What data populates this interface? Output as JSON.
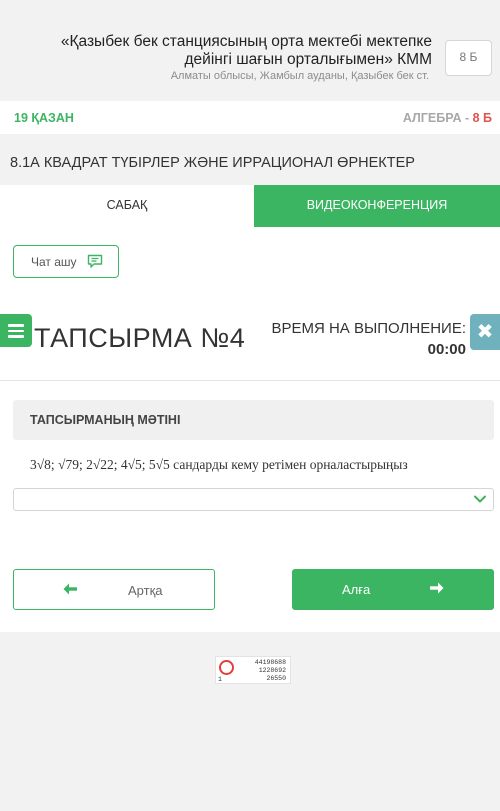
{
  "header": {
    "school_name": "«Қазыбек бек станциясының орта мектебі мектепке дейінгі шағын орталығымен» КММ",
    "address": "Алматы облысы, Жамбыл ауданы, Қазыбек бек ст.",
    "class": "8 Б"
  },
  "lesson": {
    "date": "19 ҚАЗАН",
    "subject": "АЛГЕБРА",
    "subject_sep": " - ",
    "grade": "8 Б",
    "topic": "8.1А КВАДРАТ ТҮБІРЛЕР ЖӘНЕ ИРРАЦИОНАЛ ӨРНЕКТЕР"
  },
  "tabs": {
    "lesson": "САБАҚ",
    "video": "ВИДЕОКОНФЕРЕНЦИЯ"
  },
  "chat": {
    "label": "Чат ашу",
    "icon": "chat-bubble-icon"
  },
  "task": {
    "title": "ТАПСЫРМА №4",
    "time_label": "ВРЕМЯ НА ВЫПОЛНЕНИЕ:",
    "time_value": "00:00",
    "text_header": "ТАПСЫРМАНЫҢ МӘТІНІ",
    "question": "3√8; √79; 2√22; 4√5; 5√5 сандарды кему ретімен орналастырыңыз",
    "answer_value": ""
  },
  "nav": {
    "back": "Артқа",
    "next": "Алға"
  },
  "widget": {
    "line1": "44198688",
    "line2": "1228692",
    "line3": "26550",
    "mark": "1"
  },
  "colors": {
    "accent": "#3cb563",
    "grade_red": "#e0524f",
    "close_teal": "#6fb1bc"
  }
}
